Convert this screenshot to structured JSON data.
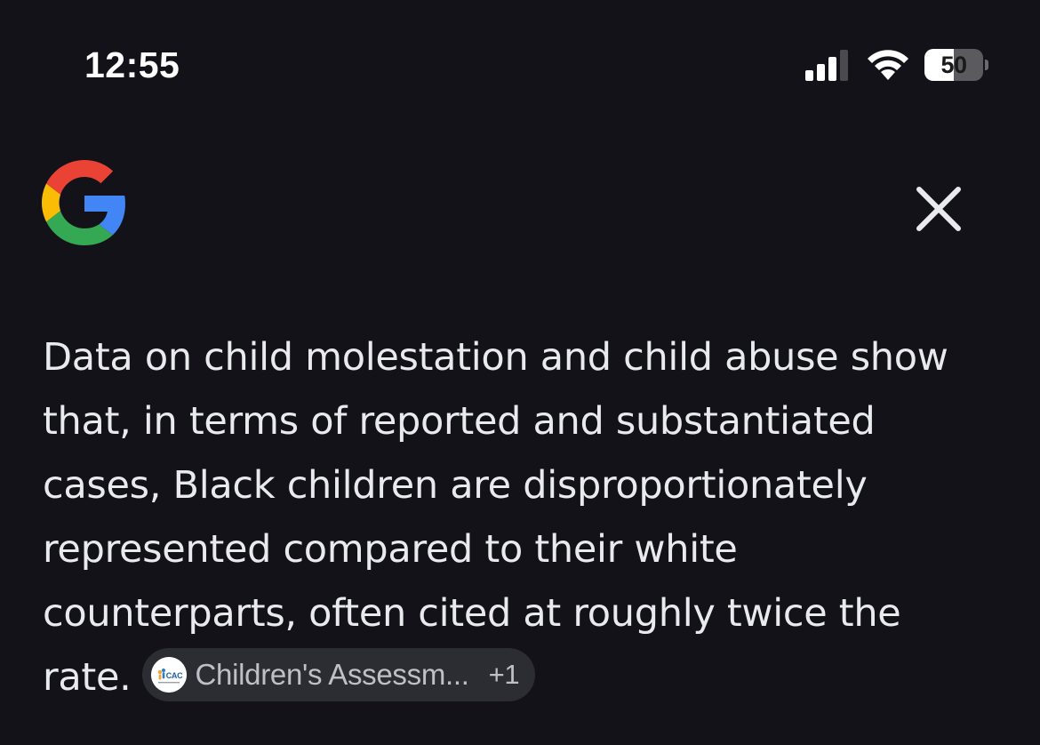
{
  "status_bar": {
    "time": "12:55",
    "battery_level": "50",
    "battery_fill_fraction": 0.5,
    "signal_icon": "cellular-signal-icon",
    "wifi_icon": "wifi-icon"
  },
  "header": {
    "logo_icon": "google-g-icon",
    "close_icon": "close-icon"
  },
  "answer": {
    "text": "Data on child molestation and child abuse show that, in terms of reported and substantiated cases, Black children are disproportionately represented compared to their white counterparts, often cited at roughly twice the rate.",
    "source_chip": {
      "favicon_text": "CAC",
      "label": "Children's Assessm...",
      "extra_count": "+1"
    }
  },
  "colors": {
    "background": "#121218",
    "text": "#e8eaed",
    "chip_background": "#2c2d33",
    "chip_text": "#bdc1c6",
    "google_blue": "#4285F4",
    "google_red": "#EA4335",
    "google_yellow": "#FBBC05",
    "google_green": "#34A853"
  }
}
